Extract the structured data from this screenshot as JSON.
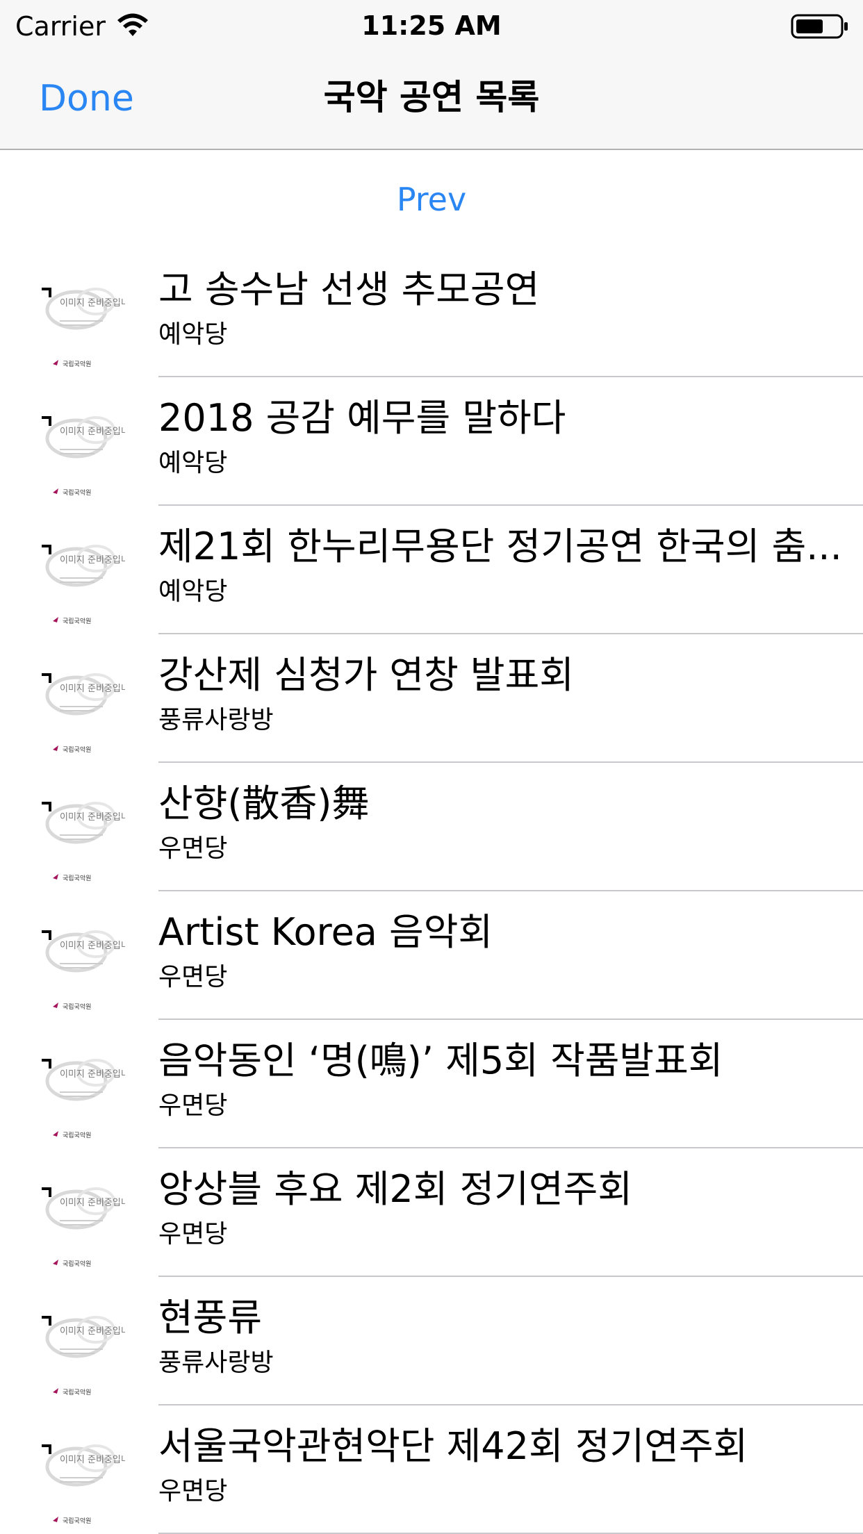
{
  "status_bar": {
    "carrier": "Carrier",
    "time": "11:25 AM"
  },
  "nav": {
    "done_label": "Done",
    "title": "국악 공연 목록"
  },
  "prev_label": "Prev",
  "items": [
    {
      "title": "고 송수남 선생 추모공연",
      "venue": "예악당"
    },
    {
      "title": "2018 공감 예무를 말하다",
      "venue": "예악당"
    },
    {
      "title": "제21회 한누리무용단 정기공연 한국의 춤...",
      "venue": "예악당"
    },
    {
      "title": "강산제 심청가 연창 발표회",
      "venue": "풍류사랑방"
    },
    {
      "title": "산향(散香)舞",
      "venue": "우면당"
    },
    {
      "title": "Artist Korea 음악회",
      "venue": "우면당"
    },
    {
      "title": "음악동인 ‘명(鳴)’ 제5회 작품발표회",
      "venue": "우면당"
    },
    {
      "title": "앙상블 후요 제2회 정기연주회",
      "venue": "우면당"
    },
    {
      "title": "현풍류",
      "venue": "풍류사랑방"
    },
    {
      "title": "서울국악관현악단 제42회 정기연주회",
      "venue": "우면당"
    }
  ],
  "thumbnail": {
    "text": "이미지 준비중입니다",
    "logo_text": "국립국악원"
  },
  "colors": {
    "accent": "#2a86f3",
    "bar_background": "#f7f7f7",
    "separator": "#c8c7cc"
  }
}
